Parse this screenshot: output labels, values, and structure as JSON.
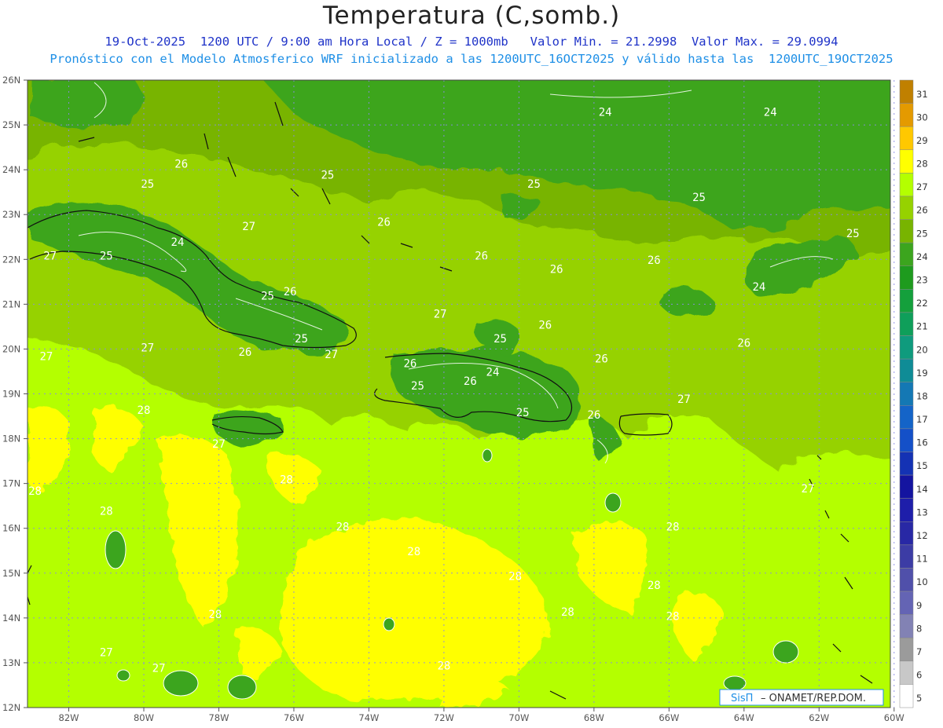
{
  "header": {
    "title": "Temperatura (C,somb.)",
    "line1": "19-Oct-2025  1200 UTC / 9:00 am Hora Local / Z = 1000mb   Valor Min. = 21.2998  Valor Max. = 29.0994",
    "line2": "Pronóstico con el Modelo Atmosferico WRF inicializado a las 1200UTC_16OCT2025 y válido hasta las  1200UTC_19OCT2025"
  },
  "axes": {
    "lat_labels": [
      "26N",
      "25N",
      "24N",
      "23N",
      "22N",
      "21N",
      "20N",
      "19N",
      "18N",
      "17N",
      "16N",
      "15N",
      "14N",
      "13N",
      "12N"
    ],
    "lon_labels": [
      "82W",
      "80W",
      "78W",
      "76W",
      "74W",
      "72W",
      "70W",
      "68W",
      "66W",
      "64W",
      "62W",
      "60W"
    ]
  },
  "colorbar": {
    "labels": [
      "31",
      "30",
      "29",
      "28",
      "27",
      "26",
      "25",
      "24",
      "23",
      "22",
      "21",
      "20",
      "19",
      "18",
      "17",
      "16",
      "15",
      "14",
      "13",
      "12",
      "11",
      "10",
      "9",
      "8",
      "7",
      "6",
      "5"
    ],
    "colors": [
      "#c08000",
      "#e49a00",
      "#ffc800",
      "#ffff00",
      "#b4ff00",
      "#96d200",
      "#78b400",
      "#3ca51e",
      "#1e9b1e",
      "#14a03c",
      "#0f9f5a",
      "#0f9b7d",
      "#0f8c96",
      "#1478b4",
      "#1464c8",
      "#1450c8",
      "#1432b4",
      "#1414a0",
      "#1e1eaa",
      "#2828a5",
      "#3c3ca5",
      "#5050aa",
      "#6464b4",
      "#8282b4",
      "#9b9b9b",
      "#c8c8c8",
      "#ffffff"
    ]
  },
  "contour_labels": [
    {
      "t": "26",
      "lon": -79.0,
      "lat": 24.05
    },
    {
      "t": "25",
      "lon": -79.9,
      "lat": 23.6
    },
    {
      "t": "25",
      "lon": -75.1,
      "lat": 23.8
    },
    {
      "t": "25",
      "lon": -69.6,
      "lat": 23.6
    },
    {
      "t": "25",
      "lon": -65.2,
      "lat": 23.3
    },
    {
      "t": "24",
      "lon": -67.7,
      "lat": 25.2
    },
    {
      "t": "24",
      "lon": -63.3,
      "lat": 25.2
    },
    {
      "t": "26",
      "lon": -73.6,
      "lat": 22.75
    },
    {
      "t": "27",
      "lon": -77.2,
      "lat": 22.65
    },
    {
      "t": "26",
      "lon": -71.0,
      "lat": 22.0
    },
    {
      "t": "27",
      "lon": -82.5,
      "lat": 22.0
    },
    {
      "t": "25",
      "lon": -81.0,
      "lat": 22.0
    },
    {
      "t": "24",
      "lon": -79.1,
      "lat": 22.3
    },
    {
      "t": "26",
      "lon": -66.4,
      "lat": 21.9
    },
    {
      "t": "26",
      "lon": -69.0,
      "lat": 21.7
    },
    {
      "t": "25",
      "lon": -61.1,
      "lat": 22.5
    },
    {
      "t": "24",
      "lon": -63.6,
      "lat": 21.3
    },
    {
      "t": "25",
      "lon": -76.7,
      "lat": 21.1
    },
    {
      "t": "26",
      "lon": -76.1,
      "lat": 21.2
    },
    {
      "t": "27",
      "lon": -72.1,
      "lat": 20.7
    },
    {
      "t": "26",
      "lon": -69.3,
      "lat": 20.45
    },
    {
      "t": "25",
      "lon": -75.8,
      "lat": 20.15
    },
    {
      "t": "25",
      "lon": -70.5,
      "lat": 20.15
    },
    {
      "t": "26",
      "lon": -64.0,
      "lat": 20.05
    },
    {
      "t": "27",
      "lon": -82.6,
      "lat": 19.75
    },
    {
      "t": "27",
      "lon": -79.9,
      "lat": 19.95
    },
    {
      "t": "26",
      "lon": -77.3,
      "lat": 19.85
    },
    {
      "t": "27",
      "lon": -75.0,
      "lat": 19.8
    },
    {
      "t": "26",
      "lon": -72.9,
      "lat": 19.6
    },
    {
      "t": "24",
      "lon": -70.7,
      "lat": 19.4
    },
    {
      "t": "26",
      "lon": -67.8,
      "lat": 19.7
    },
    {
      "t": "25",
      "lon": -72.7,
      "lat": 19.1
    },
    {
      "t": "26",
      "lon": -71.3,
      "lat": 19.2
    },
    {
      "t": "25",
      "lon": -69.9,
      "lat": 18.5
    },
    {
      "t": "26",
      "lon": -68.0,
      "lat": 18.45
    },
    {
      "t": "27",
      "lon": -65.6,
      "lat": 18.8
    },
    {
      "t": "28",
      "lon": -80.0,
      "lat": 18.55
    },
    {
      "t": "27",
      "lon": -78.0,
      "lat": 17.8
    },
    {
      "t": "28",
      "lon": -76.2,
      "lat": 17.0
    },
    {
      "t": "28",
      "lon": -82.9,
      "lat": 16.75
    },
    {
      "t": "27",
      "lon": -62.3,
      "lat": 16.8
    },
    {
      "t": "28",
      "lon": -81.0,
      "lat": 16.3
    },
    {
      "t": "28",
      "lon": -74.7,
      "lat": 15.95
    },
    {
      "t": "28",
      "lon": -65.9,
      "lat": 15.95
    },
    {
      "t": "28",
      "lon": -72.8,
      "lat": 15.4
    },
    {
      "t": "28",
      "lon": -70.1,
      "lat": 14.85
    },
    {
      "t": "28",
      "lon": -66.4,
      "lat": 14.65
    },
    {
      "t": "28",
      "lon": -78.1,
      "lat": 14.0
    },
    {
      "t": "28",
      "lon": -68.7,
      "lat": 14.05
    },
    {
      "t": "28",
      "lon": -65.9,
      "lat": 13.95
    },
    {
      "t": "27",
      "lon": -81.0,
      "lat": 13.15
    },
    {
      "t": "27",
      "lon": -79.6,
      "lat": 12.8
    },
    {
      "t": "28",
      "lon": -72.0,
      "lat": 12.85
    }
  ],
  "credit": {
    "brand": "SisΠ",
    "org": " – ONAMET/REP.DOM."
  }
}
